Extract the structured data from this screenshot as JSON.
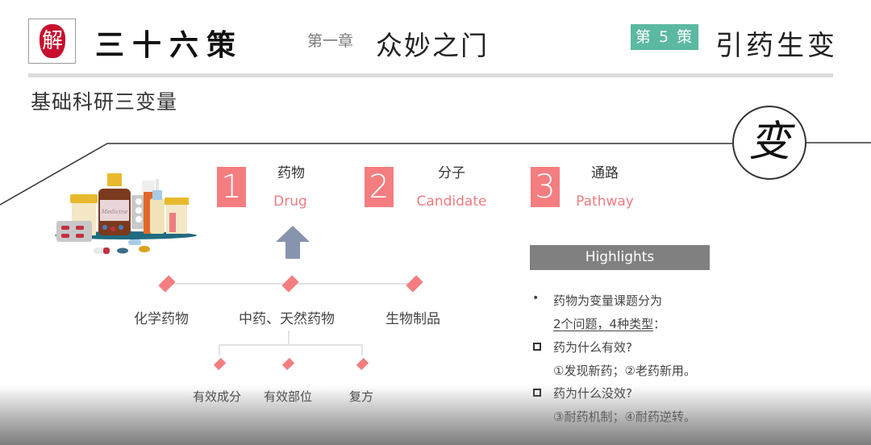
{
  "header": {
    "seal_char": "解",
    "brand": "三十六策",
    "chapter_number": "第一章",
    "chapter_title": "众妙之门",
    "strategy_badge": "第 5 策",
    "strategy_title": "引药生变"
  },
  "section_title": "基础科研三变量",
  "circle_char": "变",
  "variables": [
    {
      "number": "1",
      "cn": "药物",
      "en": "Drug"
    },
    {
      "number": "2",
      "cn": "分子",
      "en": "Candidate"
    },
    {
      "number": "3",
      "cn": "通路",
      "en": "Pathway"
    }
  ],
  "drug_categories": [
    "化学药物",
    "中药、天然药物",
    "生物制品"
  ],
  "tcm_subtypes": [
    "有效成分",
    "有效部位",
    "复方"
  ],
  "highlights": {
    "title": "Highlights",
    "intro_line1": "药物为变量课题分为",
    "intro_line2": "2个问题，4种类型",
    "intro_line2_suffix": "：",
    "q1": "药为什么有效?",
    "q1_answer": "①发现新药；②老药新用。",
    "q2": "药为什么没效?",
    "q2_answer": "③耐药机制；④耐药逆转。"
  },
  "colors": {
    "accent_pink": "#f47d80",
    "badge_green": "#5bb8a1",
    "highlights_gray": "#808080",
    "arrow_blue_gray": "#8794ae",
    "seal_red": "#c8102e"
  }
}
